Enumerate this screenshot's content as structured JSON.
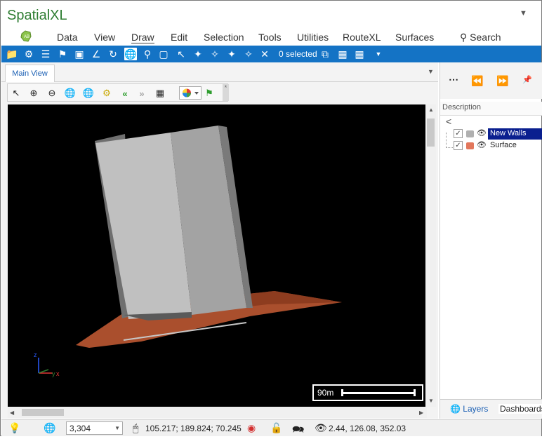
{
  "app": {
    "title": "SpatialXL"
  },
  "menu": {
    "items": [
      "Data",
      "View",
      "Draw",
      "Edit",
      "Selection",
      "Tools",
      "Utilities",
      "RouteXL",
      "Surfaces"
    ],
    "active": "Draw",
    "search_label": "Search"
  },
  "ribbon": {
    "selected_text": "0 selected"
  },
  "document": {
    "tab_label": "Main View"
  },
  "viewport": {
    "scale_label": "90m",
    "axis_z": "z",
    "axis_y": "y",
    "axis_x": "x"
  },
  "panel": {
    "description_header": "Description",
    "layers": [
      {
        "name": "New Walls",
        "checked": true,
        "selected": true,
        "swatch": "#b0b0b0"
      },
      {
        "name": "Surface",
        "checked": true,
        "selected": false,
        "swatch": "#e2775c"
      }
    ],
    "tabs": {
      "layers": "Layers",
      "dashboards": "Dashboards"
    }
  },
  "status": {
    "zoom_value": "3,304",
    "mouse_coords": "105.217; 189.824; 70.245",
    "eye_coords": "2.44, 126.08, 352.03"
  },
  "colors": {
    "brand_green": "#2e7d32",
    "ribbon_blue": "#1473c5",
    "selection_navy": "#0a1f8f"
  }
}
